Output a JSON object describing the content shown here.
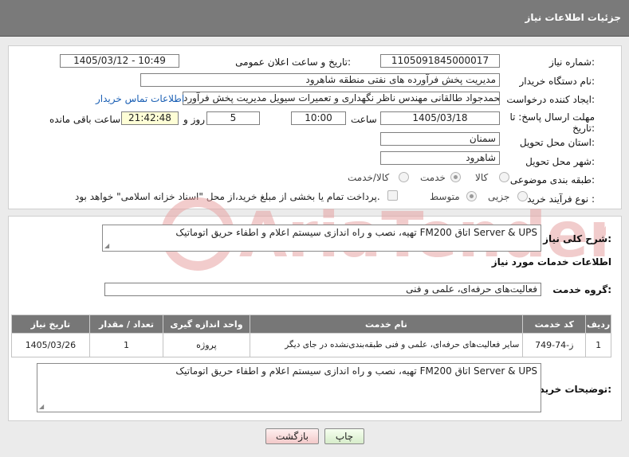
{
  "header": {
    "title": "جزئیات اطلاعات نیاز"
  },
  "fields": {
    "need_number_label": "شماره نیاز:",
    "need_number": "1105091845000017",
    "announce_label": "تاریخ و ساعت اعلان عمومی:",
    "announce_value": "1405/03/12 - 10:49",
    "buyer_org_label": "نام دستگاه خریدار:",
    "buyer_org": "مدیریت پخش فرآورده های نفتی منطقه شاهرود",
    "creator_label": "ایجاد کننده درخواست:",
    "creator": "محمدجواد طالقانی مهندس ناظر نگهداری و تعمیرات سیویل مدیریت پخش فرآورد",
    "contact_link": "اطلاعات تماس خریدار",
    "deadline_label": "مهلت ارسال پاسخ: تا تاریخ:",
    "deadline_date": "1405/03/18",
    "time_label": "ساعت",
    "deadline_time": "10:00",
    "days_value": "5",
    "days_label": "روز و",
    "remaining_time": "21:42:48",
    "remaining_label": "ساعت باقی مانده",
    "province_label": "استان محل تحویل:",
    "province": "سمنان",
    "city_label": "شهر محل تحویل:",
    "city": "شاهرود",
    "category_label": "طبقه بندی موضوعی:",
    "category_options": [
      "کالا",
      "خدمت",
      "کالا/خدمت"
    ],
    "process_label": "نوع فرآیند خرید :",
    "process_options": [
      "جزیی",
      "متوسط"
    ],
    "payment_note": "پرداخت تمام یا بخشی از مبلغ خرید،از محل \"اسناد خزانه اسلامی\" خواهد بود."
  },
  "summary": {
    "label": "شرح کلی نیاز:",
    "text": "تهیه، نصب و راه اندازی سیستم اعلام و اطفاء حریق اتوماتیک FM200 اتاق Server & UPS"
  },
  "services": {
    "section_title": "اطلاعات خدمات مورد نیاز",
    "group_label": "گروه خدمت:",
    "group_value": "فعالیت‌های حرفه‌ای، علمی و فنی"
  },
  "table": {
    "headers": [
      "ردیف",
      "کد خدمت",
      "نام خدمت",
      "واحد اندازه گیری",
      "تعداد / مقدار",
      "تاریخ نیاز"
    ],
    "rows": [
      [
        "1",
        "ز-74-749",
        "سایر فعالیت‌های حرفه‌ای، علمی و فنی طبقه‌بندی‌نشده در جای دیگر",
        "پروژه",
        "1",
        "1405/03/26"
      ]
    ]
  },
  "buyer_notes": {
    "label": "توضیحات خریدار:",
    "text": "تهیه، نصب و راه اندازی سیستم اعلام و اطفاء حریق اتوماتیک FM200 اتاق Server & UPS"
  },
  "buttons": {
    "print": "چاپ",
    "back": "بازگشت"
  },
  "watermark": {
    "text": "AriaTender.net"
  },
  "colors": {
    "header_bg": "#7a7a7a",
    "link": "#1a5fb4",
    "watermark": "#d9534f"
  }
}
